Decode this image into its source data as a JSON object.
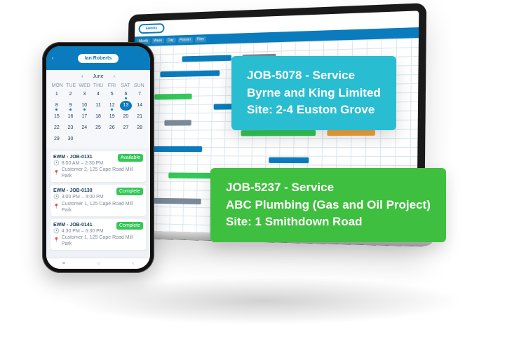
{
  "phone": {
    "header_title": "Ian Roberts",
    "month_label": "June",
    "dow": [
      "MON",
      "TUE",
      "WED",
      "THU",
      "FRI",
      "SAT",
      "SUN"
    ],
    "days": [
      "1",
      "2",
      "3",
      "4",
      "5",
      "6",
      "7",
      "8",
      "9",
      "10",
      "11",
      "12",
      "13",
      "14",
      "15",
      "16",
      "17",
      "18",
      "19",
      "20",
      "21",
      "22",
      "23",
      "24",
      "25",
      "26",
      "27",
      "28",
      "29",
      "30"
    ],
    "current_day": "13",
    "jobs": [
      {
        "title": "EWM - JOB-0131",
        "time": "8:00 AM – 2:30 PM",
        "location": "Customer 2, 125 Cape Road Mill Park",
        "status": "Available"
      },
      {
        "title": "EWM - JOB-0130",
        "time": "3:00 PM – 4:00 PM",
        "location": "Customer 1, 125 Cape Road Mill Park",
        "status": "Complete"
      },
      {
        "title": "EWM - JOB-0141",
        "time": "4:30 PM – 6:30 PM",
        "location": "Customer 1, 125 Cape Road Mill Park",
        "status": "Complete"
      }
    ]
  },
  "laptop": {
    "logo_text": "Eworks",
    "toolbar": [
      "Month",
      "Week",
      "Day",
      "Planner",
      "Filter"
    ]
  },
  "callouts": {
    "teal": {
      "line1": "JOB-5078 - Service",
      "line2": "Byrne and King Limited",
      "line3": "Site: 2-4 Euston Grove"
    },
    "green": {
      "line1": "JOB-5237 - Service",
      "line2": "ABC Plumbing (Gas and Oil Project)",
      "line3": "Site: 1 Smithdown Road"
    }
  }
}
